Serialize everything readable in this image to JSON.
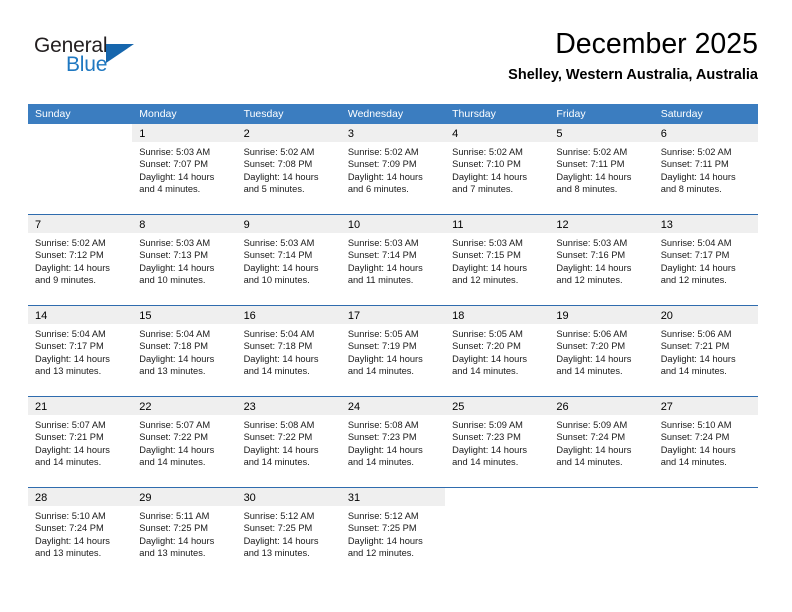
{
  "logo": {
    "word_one": "General",
    "word_two": "Blue",
    "icon": "triangle-mark"
  },
  "header": {
    "title": "December 2025",
    "subtitle": "Shelley, Western Australia, Australia"
  },
  "calendar": {
    "weekday_headers": [
      "Sunday",
      "Monday",
      "Tuesday",
      "Wednesday",
      "Thursday",
      "Friday",
      "Saturday"
    ],
    "colors": {
      "header_blue": "#3b7dc0",
      "separator_blue": "#2f6cae",
      "daynum_band": "#efefef",
      "logo_blue": "#1f78c1"
    },
    "weeks": [
      [
        {
          "day": "",
          "lines": []
        },
        {
          "day": "1",
          "lines": [
            "Sunrise: 5:03 AM",
            "Sunset: 7:07 PM",
            "Daylight: 14 hours",
            "and 4 minutes."
          ]
        },
        {
          "day": "2",
          "lines": [
            "Sunrise: 5:02 AM",
            "Sunset: 7:08 PM",
            "Daylight: 14 hours",
            "and 5 minutes."
          ]
        },
        {
          "day": "3",
          "lines": [
            "Sunrise: 5:02 AM",
            "Sunset: 7:09 PM",
            "Daylight: 14 hours",
            "and 6 minutes."
          ]
        },
        {
          "day": "4",
          "lines": [
            "Sunrise: 5:02 AM",
            "Sunset: 7:10 PM",
            "Daylight: 14 hours",
            "and 7 minutes."
          ]
        },
        {
          "day": "5",
          "lines": [
            "Sunrise: 5:02 AM",
            "Sunset: 7:11 PM",
            "Daylight: 14 hours",
            "and 8 minutes."
          ]
        },
        {
          "day": "6",
          "lines": [
            "Sunrise: 5:02 AM",
            "Sunset: 7:11 PM",
            "Daylight: 14 hours",
            "and 8 minutes."
          ]
        }
      ],
      [
        {
          "day": "7",
          "lines": [
            "Sunrise: 5:02 AM",
            "Sunset: 7:12 PM",
            "Daylight: 14 hours",
            "and 9 minutes."
          ]
        },
        {
          "day": "8",
          "lines": [
            "Sunrise: 5:03 AM",
            "Sunset: 7:13 PM",
            "Daylight: 14 hours",
            "and 10 minutes."
          ]
        },
        {
          "day": "9",
          "lines": [
            "Sunrise: 5:03 AM",
            "Sunset: 7:14 PM",
            "Daylight: 14 hours",
            "and 10 minutes."
          ]
        },
        {
          "day": "10",
          "lines": [
            "Sunrise: 5:03 AM",
            "Sunset: 7:14 PM",
            "Daylight: 14 hours",
            "and 11 minutes."
          ]
        },
        {
          "day": "11",
          "lines": [
            "Sunrise: 5:03 AM",
            "Sunset: 7:15 PM",
            "Daylight: 14 hours",
            "and 12 minutes."
          ]
        },
        {
          "day": "12",
          "lines": [
            "Sunrise: 5:03 AM",
            "Sunset: 7:16 PM",
            "Daylight: 14 hours",
            "and 12 minutes."
          ]
        },
        {
          "day": "13",
          "lines": [
            "Sunrise: 5:04 AM",
            "Sunset: 7:17 PM",
            "Daylight: 14 hours",
            "and 12 minutes."
          ]
        }
      ],
      [
        {
          "day": "14",
          "lines": [
            "Sunrise: 5:04 AM",
            "Sunset: 7:17 PM",
            "Daylight: 14 hours",
            "and 13 minutes."
          ]
        },
        {
          "day": "15",
          "lines": [
            "Sunrise: 5:04 AM",
            "Sunset: 7:18 PM",
            "Daylight: 14 hours",
            "and 13 minutes."
          ]
        },
        {
          "day": "16",
          "lines": [
            "Sunrise: 5:04 AM",
            "Sunset: 7:18 PM",
            "Daylight: 14 hours",
            "and 14 minutes."
          ]
        },
        {
          "day": "17",
          "lines": [
            "Sunrise: 5:05 AM",
            "Sunset: 7:19 PM",
            "Daylight: 14 hours",
            "and 14 minutes."
          ]
        },
        {
          "day": "18",
          "lines": [
            "Sunrise: 5:05 AM",
            "Sunset: 7:20 PM",
            "Daylight: 14 hours",
            "and 14 minutes."
          ]
        },
        {
          "day": "19",
          "lines": [
            "Sunrise: 5:06 AM",
            "Sunset: 7:20 PM",
            "Daylight: 14 hours",
            "and 14 minutes."
          ]
        },
        {
          "day": "20",
          "lines": [
            "Sunrise: 5:06 AM",
            "Sunset: 7:21 PM",
            "Daylight: 14 hours",
            "and 14 minutes."
          ]
        }
      ],
      [
        {
          "day": "21",
          "lines": [
            "Sunrise: 5:07 AM",
            "Sunset: 7:21 PM",
            "Daylight: 14 hours",
            "and 14 minutes."
          ]
        },
        {
          "day": "22",
          "lines": [
            "Sunrise: 5:07 AM",
            "Sunset: 7:22 PM",
            "Daylight: 14 hours",
            "and 14 minutes."
          ]
        },
        {
          "day": "23",
          "lines": [
            "Sunrise: 5:08 AM",
            "Sunset: 7:22 PM",
            "Daylight: 14 hours",
            "and 14 minutes."
          ]
        },
        {
          "day": "24",
          "lines": [
            "Sunrise: 5:08 AM",
            "Sunset: 7:23 PM",
            "Daylight: 14 hours",
            "and 14 minutes."
          ]
        },
        {
          "day": "25",
          "lines": [
            "Sunrise: 5:09 AM",
            "Sunset: 7:23 PM",
            "Daylight: 14 hours",
            "and 14 minutes."
          ]
        },
        {
          "day": "26",
          "lines": [
            "Sunrise: 5:09 AM",
            "Sunset: 7:24 PM",
            "Daylight: 14 hours",
            "and 14 minutes."
          ]
        },
        {
          "day": "27",
          "lines": [
            "Sunrise: 5:10 AM",
            "Sunset: 7:24 PM",
            "Daylight: 14 hours",
            "and 14 minutes."
          ]
        }
      ],
      [
        {
          "day": "28",
          "lines": [
            "Sunrise: 5:10 AM",
            "Sunset: 7:24 PM",
            "Daylight: 14 hours",
            "and 13 minutes."
          ]
        },
        {
          "day": "29",
          "lines": [
            "Sunrise: 5:11 AM",
            "Sunset: 7:25 PM",
            "Daylight: 14 hours",
            "and 13 minutes."
          ]
        },
        {
          "day": "30",
          "lines": [
            "Sunrise: 5:12 AM",
            "Sunset: 7:25 PM",
            "Daylight: 14 hours",
            "and 13 minutes."
          ]
        },
        {
          "day": "31",
          "lines": [
            "Sunrise: 5:12 AM",
            "Sunset: 7:25 PM",
            "Daylight: 14 hours",
            "and 12 minutes."
          ]
        },
        {
          "day": "",
          "lines": []
        },
        {
          "day": "",
          "lines": []
        },
        {
          "day": "",
          "lines": []
        }
      ]
    ]
  }
}
